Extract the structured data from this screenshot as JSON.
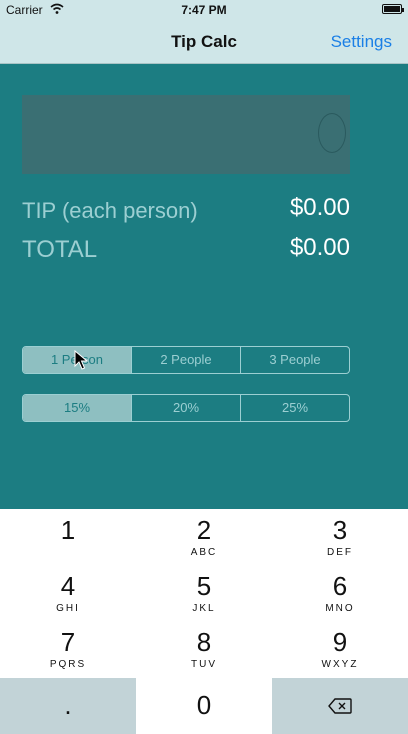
{
  "status": {
    "carrier": "Carrier",
    "time": "7:47 PM"
  },
  "nav": {
    "title": "Tip Calc",
    "settings_label": "Settings"
  },
  "tip_label": "TIP (each person)",
  "tip_value": "$0.00",
  "total_label": "TOTAL",
  "total_value": "$0.00",
  "people": [
    {
      "label": "1 Person",
      "selected": true
    },
    {
      "label": "2 People",
      "selected": false
    },
    {
      "label": "3 People",
      "selected": false
    }
  ],
  "percents": [
    {
      "label": "15%",
      "selected": true
    },
    {
      "label": "20%",
      "selected": false
    },
    {
      "label": "25%",
      "selected": false
    }
  ],
  "keypad": {
    "keys": [
      {
        "digit": "1",
        "letters": ""
      },
      {
        "digit": "2",
        "letters": "ABC"
      },
      {
        "digit": "3",
        "letters": "DEF"
      },
      {
        "digit": "4",
        "letters": "GHI"
      },
      {
        "digit": "5",
        "letters": "JKL"
      },
      {
        "digit": "6",
        "letters": "MNO"
      },
      {
        "digit": "7",
        "letters": "PQRS"
      },
      {
        "digit": "8",
        "letters": "TUV"
      },
      {
        "digit": "9",
        "letters": "WXYZ"
      }
    ],
    "dot": ".",
    "zero": "0"
  },
  "colors": {
    "background": "#1c7d82",
    "navbar": "#cfe6e8",
    "accent": "#1a7fe6",
    "muted_label": "#9ccfd2"
  }
}
